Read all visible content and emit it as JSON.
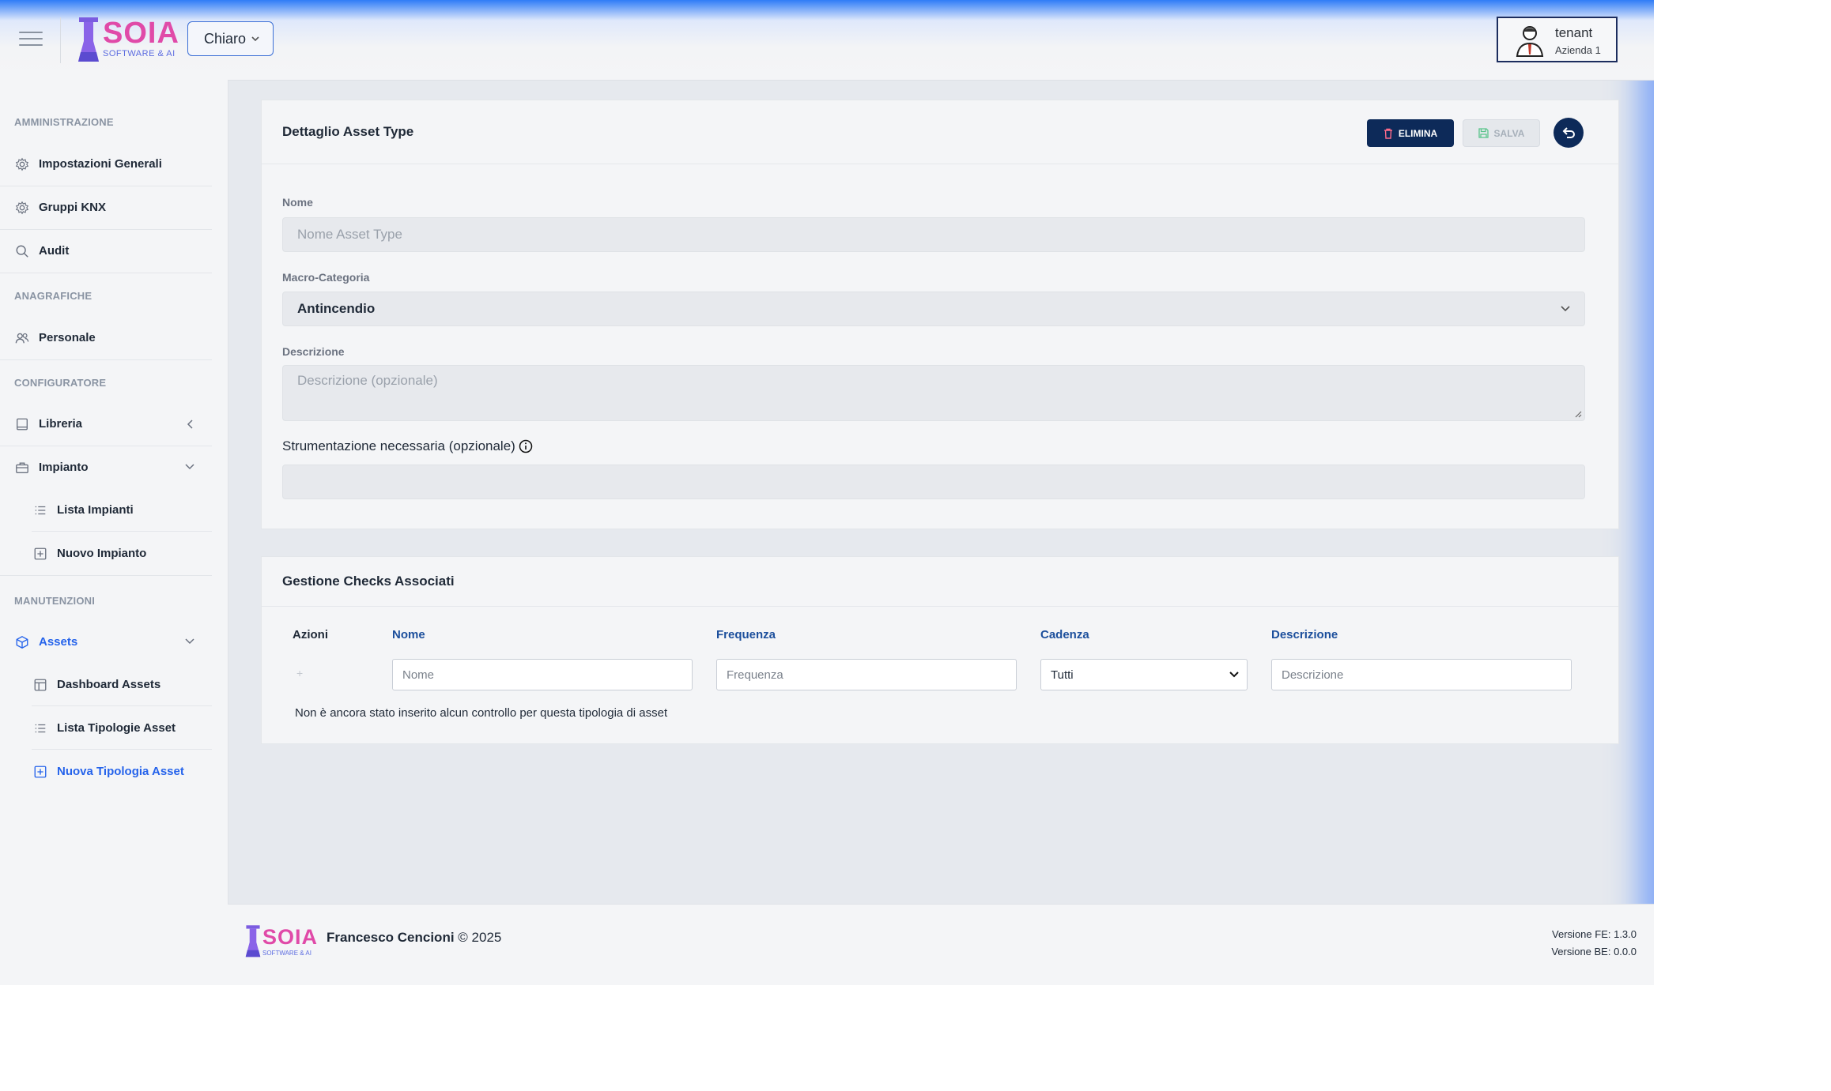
{
  "header": {
    "logo_text": "SOIA",
    "logo_subtitle": "SOFTWARE & AI",
    "theme_selected": "Chiaro",
    "user": {
      "name": "tenant",
      "company": "Azienda 1"
    }
  },
  "sidebar": {
    "sections": {
      "admin": "AMMINISTRAZIONE",
      "anagrafiche": "ANAGRAFICHE",
      "configuratore": "CONFIGURATORE",
      "manutenzioni": "MANUTENZIONI"
    },
    "items": {
      "impostazioni": "Impostazioni Generali",
      "gruppi_knx": "Gruppi KNX",
      "audit": "Audit",
      "personale": "Personale",
      "libreria": "Libreria",
      "impianto": "Impianto",
      "lista_impianti": "Lista Impianti",
      "nuovo_impianto": "Nuovo Impianto",
      "assets": "Assets",
      "dashboard_assets": "Dashboard Assets",
      "lista_tipologie": "Lista Tipologie Asset",
      "nuova_tipologia": "Nuova Tipologia Asset"
    },
    "active_item": "Nuova Tipologia Asset"
  },
  "detail": {
    "title": "Dettaglio Asset Type",
    "delete_label": "ELIMINA",
    "save_label": "SALVA",
    "fields": {
      "nome_label": "Nome",
      "nome_placeholder": "Nome Asset Type",
      "macro_label": "Macro-Categoria",
      "macro_value": "Antincendio",
      "descr_label": "Descrizione",
      "descr_placeholder": "Descrizione (opzionale)",
      "strum_label": "Strumentazione necessaria (opzionale)",
      "strum_value": ""
    }
  },
  "checks": {
    "title": "Gestione Checks Associati",
    "columns": {
      "azioni": "Azioni",
      "nome": "Nome",
      "frequenza": "Frequenza",
      "cadenza": "Cadenza",
      "descrizione": "Descrizione"
    },
    "filters": {
      "nome_placeholder": "Nome",
      "frequenza_placeholder": "Frequenza",
      "cadenza_value": "Tutti",
      "descrizione_placeholder": "Descrizione"
    },
    "add_symbol": "+",
    "empty_message": "Non è ancora stato inserito alcun controllo per questa tipologia di asset"
  },
  "footer": {
    "author": "Francesco Cencioni",
    "copyright_suffix": "© 2025",
    "version_fe": "Versione FE: 1.3.0",
    "version_be": "Versione BE: 0.0.0"
  },
  "colors": {
    "primary": "#0d2a59",
    "accent": "#2563eb",
    "logo_pink": "#e04aa8",
    "logo_purple": "#5b6be0"
  }
}
